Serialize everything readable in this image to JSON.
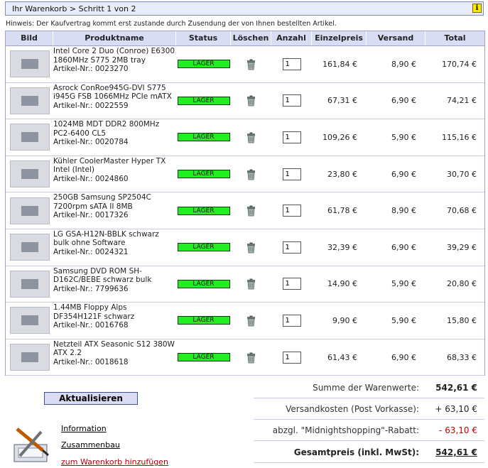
{
  "header": {
    "breadcrumb": "Ihr Warenkorb > Schritt 1 von 2",
    "info_icon": "i"
  },
  "hint": "Hinweis: Der Kaufvertrag kommt erst zustande durch Zusendung der von Ihnen bestellten Artikel.",
  "table": {
    "columns": [
      "Bild",
      "Produktname",
      "Status",
      "Löschen",
      "Anzahl",
      "Einzelpreis",
      "Versand",
      "Total"
    ],
    "items": [
      {
        "name": "Intel Core 2 Duo (Conroe) E6300 1860MHz S775 2MB tray",
        "article": "Artikel-Nr.: 0023270",
        "status": "LAGER",
        "quantity": "1",
        "unit_price": "161,84 €",
        "shipping": "8,90 €",
        "total": "170,74 €"
      },
      {
        "name": "Asrock ConRoe945G-DVI S775 i945G FSB 1066MHz PCIe mATX",
        "article": "Artikel-Nr.: 0022559",
        "status": "LAGER",
        "quantity": "1",
        "unit_price": "67,31 €",
        "shipping": "6,90 €",
        "total": "74,21 €"
      },
      {
        "name": "1024MB MDT DDR2 800MHz PC2-6400 CL5",
        "article": "Artikel-Nr.: 0020784",
        "status": "LAGER",
        "quantity": "1",
        "unit_price": "109,26 €",
        "shipping": "5,90 €",
        "total": "115,16 €"
      },
      {
        "name": "Kühler CoolerMaster Hyper TX Intel (Intel)",
        "article": "Artikel-Nr.: 0024860",
        "status": "LAGER",
        "quantity": "1",
        "unit_price": "23,80 €",
        "shipping": "6,90 €",
        "total": "30,70 €"
      },
      {
        "name": "250GB Samsung SP2504C 7200rpm sATA II 8MB",
        "article": "Artikel-Nr.: 0017326",
        "status": "LAGER",
        "quantity": "1",
        "unit_price": "61,78 €",
        "shipping": "8,90 €",
        "total": "70,68 €"
      },
      {
        "name": "LG GSA-H12N-BBLK schwarz bulk ohne Software",
        "article": "Artikel-Nr.: 0024321",
        "status": "LAGER",
        "quantity": "1",
        "unit_price": "32,39 €",
        "shipping": "6,90 €",
        "total": "39,29 €"
      },
      {
        "name": "Samsung DVD ROM SH-D162C/BEBE schwarz bulk",
        "article": "Artikel-Nr.: 7799636",
        "status": "LAGER",
        "quantity": "1",
        "unit_price": "14,90 €",
        "shipping": "5,90 €",
        "total": "20,80 €"
      },
      {
        "name": "1.44MB Floppy Alps DF354H121F schwarz",
        "article": "Artikel-Nr.: 0016768",
        "status": "LAGER",
        "quantity": "1",
        "unit_price": "9,90 €",
        "shipping": "5,90 €",
        "total": "15,80 €"
      },
      {
        "name": "Netzteil ATX Seasonic S12 380W ATX 2.2",
        "article": "Artikel-Nr.: 0018618",
        "status": "LAGER",
        "quantity": "1",
        "unit_price": "61,43 €",
        "shipping": "6,90 €",
        "total": "68,33 €"
      }
    ]
  },
  "actions": {
    "update_label": "Aktualisieren"
  },
  "links": [
    "Information",
    "Zusammenbau",
    "zum Warenkorb hinzufügen"
  ],
  "summary": {
    "subtotal_label": "Summe der Warenwerte:",
    "subtotal_value": "542,61 €",
    "shipping_label": "Versandkosten (Post Vorkasse):",
    "shipping_value": "+ 63,10 €",
    "discount_label": "abzgl. \"Midnightshopping\"-Rabatt:",
    "discount_value": "- 63,10 €",
    "grand_total_label": "Gesamtpreis (inkl. MwSt):",
    "grand_total_value": "542,61 €"
  },
  "colors": {
    "header_bg": "#d9ddf4",
    "status_green": "#22ee22",
    "discount_red": "#c20000"
  }
}
